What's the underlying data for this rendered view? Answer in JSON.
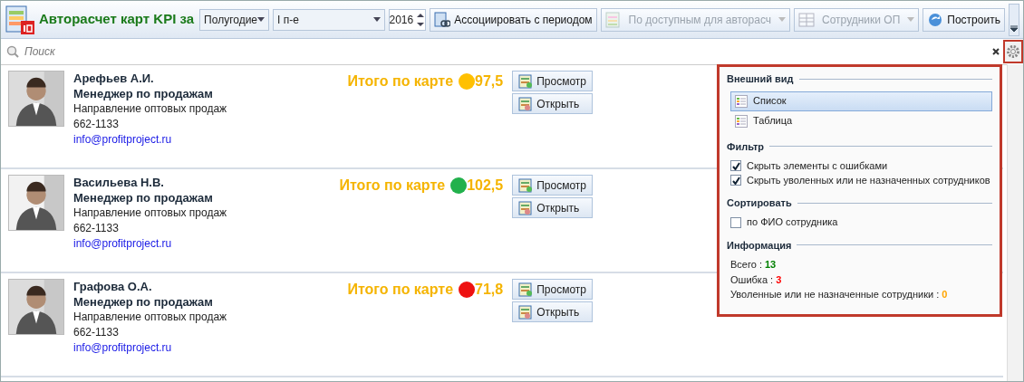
{
  "toolbar": {
    "title": "Авторасчет карт KPI за",
    "period_type": "Полугодие",
    "period": "I п-е",
    "year": "2016",
    "buttons": [
      {
        "kind": "button",
        "label": "Ассоциировать с периодом",
        "disabled": false
      },
      {
        "kind": "dropdown",
        "label": "По доступным для авторасч",
        "disabled": true
      },
      {
        "kind": "dropdown",
        "label": "Сотрудники ОП",
        "disabled": true
      },
      {
        "kind": "button",
        "label": "Построить",
        "disabled": false
      }
    ]
  },
  "search": {
    "placeholder": "Поиск"
  },
  "employees": [
    {
      "name": "Арефьев А.И.",
      "position": "Менеджер по продажам",
      "department": "Направление оптовых продаж",
      "phone": "662-1133",
      "email": "info@profitproject.ru",
      "total_label": "Итого по карте",
      "score": "97,5",
      "color": "#ffc000",
      "buttons": [
        "Просмотр",
        "Открыть"
      ]
    },
    {
      "name": "Васильева Н.В.",
      "position": "Менеджер по продажам",
      "department": "Направление оптовых продаж",
      "phone": "662-1133",
      "email": "info@profitproject.ru",
      "total_label": "Итого по карте",
      "score": "102,5",
      "color": "#22b14c",
      "buttons": [
        "Просмотр",
        "Открыть"
      ]
    },
    {
      "name": "Графова О.А.",
      "position": "Менеджер по продажам",
      "department": "Направление оптовых продаж",
      "phone": "662-1133",
      "email": "info@profitproject.ru",
      "total_label": "Итого по карте",
      "score": "71,8",
      "color": "#ee1111",
      "buttons": [
        "Просмотр",
        "Открыть"
      ]
    }
  ],
  "settings_panel": {
    "sections": [
      {
        "kind": "views",
        "title": "Внешний вид",
        "items": [
          {
            "label": "Список",
            "selected": true
          },
          {
            "label": "Таблица",
            "selected": false
          }
        ]
      },
      {
        "kind": "checks",
        "title": "Фильтр",
        "items": [
          {
            "label": "Скрыть элементы с ошибками",
            "checked": true
          },
          {
            "label": "Скрыть уволенных или не назначенных сотрудников",
            "checked": true
          }
        ]
      },
      {
        "kind": "checks",
        "title": "Сортировать",
        "items": [
          {
            "label": "по ФИО сотрудника",
            "checked": false
          }
        ]
      },
      {
        "kind": "info",
        "title": "Информация",
        "items": [
          {
            "label": "Всего :",
            "value": "13",
            "color": "#008000"
          },
          {
            "label": "Ошибка :",
            "value": "3",
            "color": "#ff0000"
          },
          {
            "label": "Уволенные или не назначенные сотрудники :",
            "value": "0",
            "color": "#ffa500"
          }
        ]
      }
    ]
  }
}
